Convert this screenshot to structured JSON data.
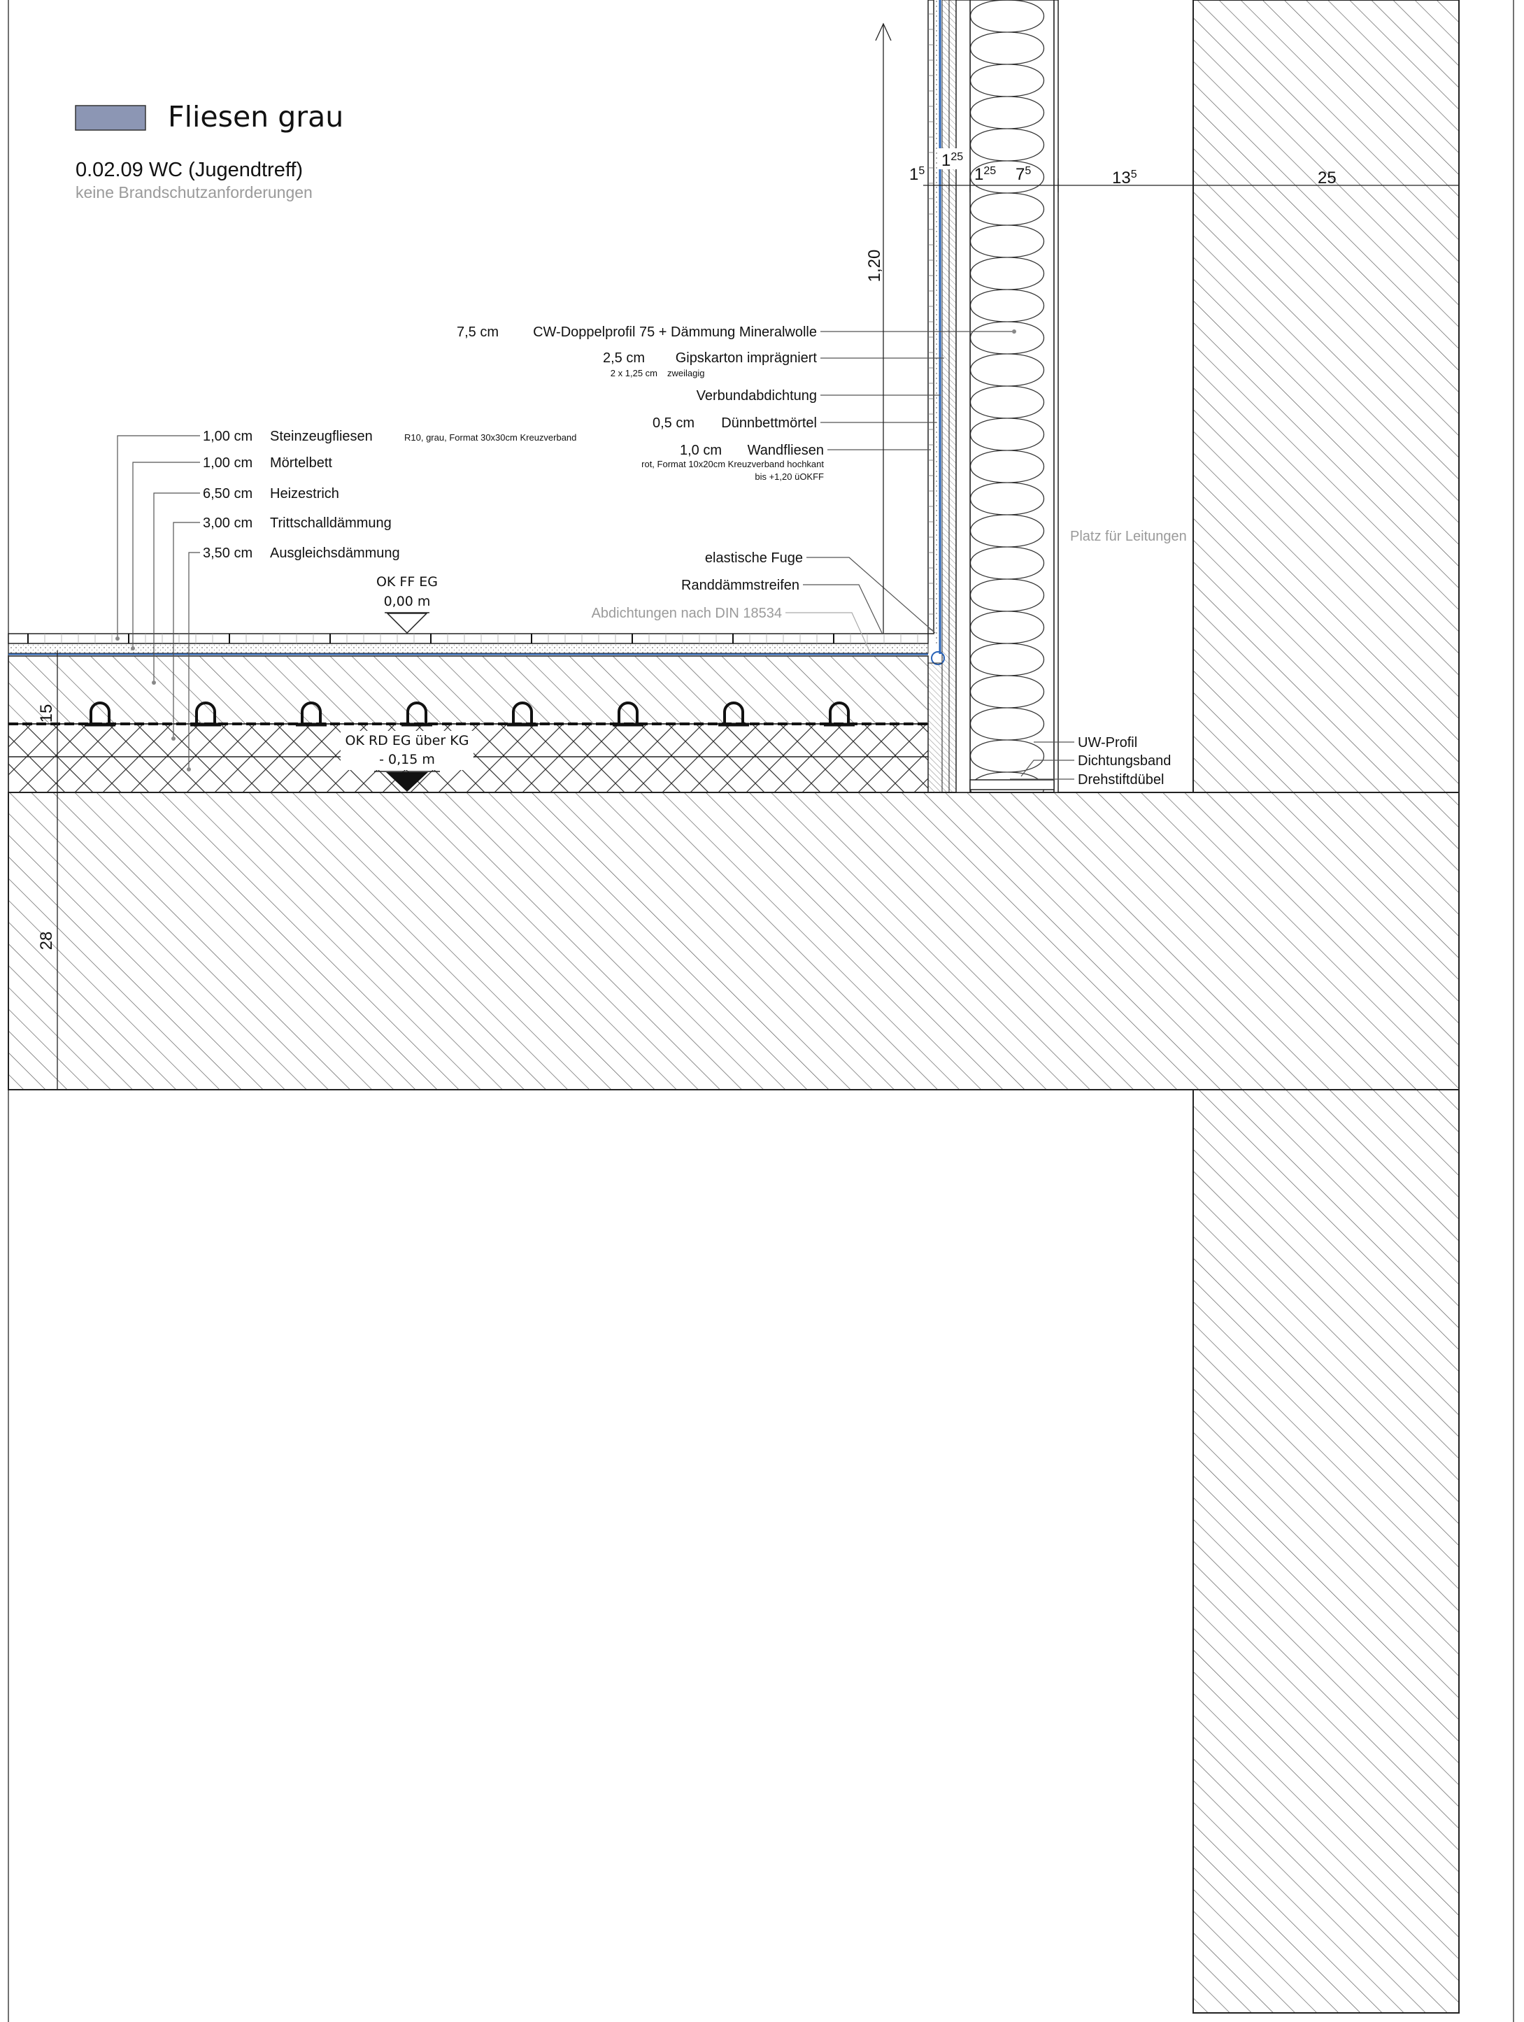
{
  "legend": {
    "swatch_label": "Fliesen grau",
    "swatch_color": "#8c96b4"
  },
  "room": {
    "title": "0.02.09 WC (Jugendtreff)",
    "subtitle": "keine Brandschutzanforderungen"
  },
  "wall_layers": {
    "cw_profile": {
      "thickness": "7,5 cm",
      "name": "CW-Doppelprofil 75 + Dämmung Mineralwolle"
    },
    "gypsum": {
      "thickness": "2,5 cm",
      "name": "Gipskarton imprägniert",
      "note_a": "2 x 1,25 cm",
      "note_b": "zweilagig"
    },
    "seal": {
      "name": "Verbundabdichtung"
    },
    "mortar": {
      "thickness": "0,5 cm",
      "name": "Dünnbettmörtel"
    },
    "wall_tiles": {
      "thickness": "1,0 cm",
      "name": "Wandfliesen",
      "note_a": "rot, Format 10x20cm Kreuzverband hochkant",
      "note_b": "bis +1,20 üOKFF"
    }
  },
  "floor_layers": [
    {
      "thickness": "1,00 cm",
      "name": "Steinzeugfliesen",
      "note": "R10, grau, Format 30x30cm Kreuzverband"
    },
    {
      "thickness": "1,00 cm",
      "name": "Mörtelbett"
    },
    {
      "thickness": "6,50 cm",
      "name": "Heizestrich"
    },
    {
      "thickness": "3,00 cm",
      "name": "Trittschalldämmung"
    },
    {
      "thickness": "3,50 cm",
      "name": "Ausgleichsdämmung"
    }
  ],
  "joints": {
    "elastic": "elastische Fuge",
    "edge_strip": "Randdämmstreifen",
    "din_note": "Abdichtungen nach DIN 18534"
  },
  "levels": {
    "ff_label": "OK FF EG",
    "ff_value": "0,00 m",
    "rd_label": "OK RD EG über KG",
    "rd_value": "- 0,15 m"
  },
  "service_zone": "Platz für Leitungen",
  "base_parts": [
    "UW-Profil",
    "Dichtungsband",
    "Drehstiftdübel"
  ],
  "dimensions": {
    "height_tiles": "1,20",
    "floor_build": "15",
    "slab": "28",
    "w1_main": "1",
    "w1_sup": "5",
    "w2_main": "1",
    "w2_sup": "25",
    "w3_main": "1",
    "w3_sup": "25",
    "w4_main": "7",
    "w4_sup": "5",
    "w5_main": "13",
    "w5_sup": "5",
    "w6": "25"
  },
  "colors": {
    "seal_line": "#2a64b8",
    "hatch": "#444444",
    "line": "#222222"
  }
}
